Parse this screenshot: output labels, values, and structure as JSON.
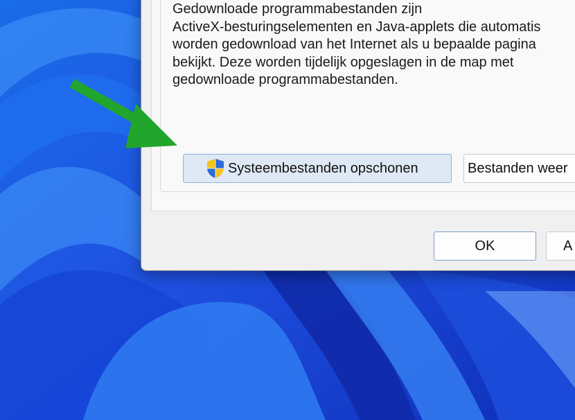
{
  "dialog": {
    "description_lines": [
      "Gedownloade programmabestanden zijn",
      "ActiveX-besturingselementen en Java-applets die automatis",
      "worden gedownload van het Internet als u bepaalde pagina",
      "bekijkt. Deze worden tijdelijk opgeslagen in de map met",
      "gedownloade programmabestanden."
    ],
    "clean_system_files_label": "Systeembestanden opschonen",
    "clean_system_files_icon": "uac-shield-icon",
    "view_files_label": "Bestanden weer",
    "ok_label": "OK",
    "cancel_label": "A"
  },
  "annotation": {
    "arrow_color": "#22a52c"
  }
}
